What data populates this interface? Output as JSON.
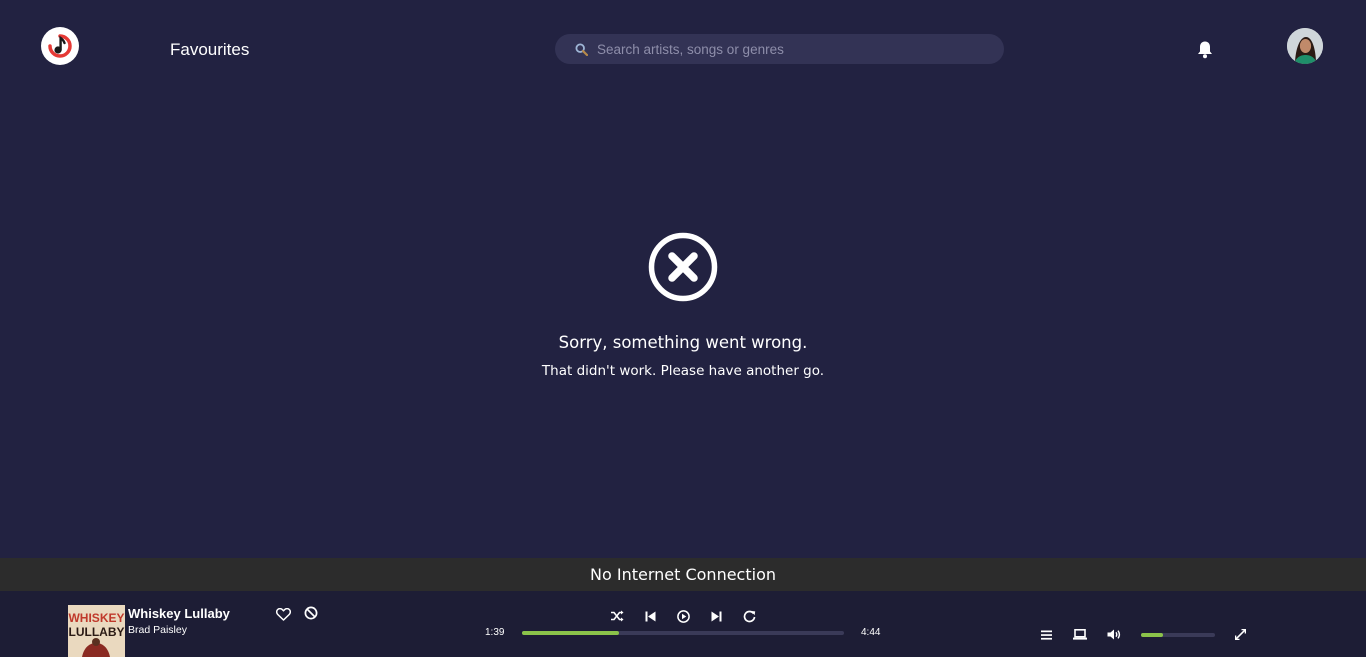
{
  "header": {
    "page_title": "Favourites",
    "search_placeholder": "Search artists, songs or genres"
  },
  "error": {
    "title": "Sorry, something went wrong.",
    "subtitle": "That didn't work. Please have another go."
  },
  "banner": {
    "offline_text": "No Internet Connection"
  },
  "player": {
    "track_title": "Whiskey Lullaby",
    "artist": "Brad Paisley",
    "cover_text_top": "WHISKEY",
    "cover_text_bottom": "LULLABY",
    "elapsed": "1:39",
    "duration": "4:44",
    "progress_percent": 30,
    "volume_percent": 30
  },
  "colors": {
    "background": "#222241",
    "accent": "#8bc34a",
    "logo_red": "#e53935",
    "banner": "#2c2c2c"
  }
}
